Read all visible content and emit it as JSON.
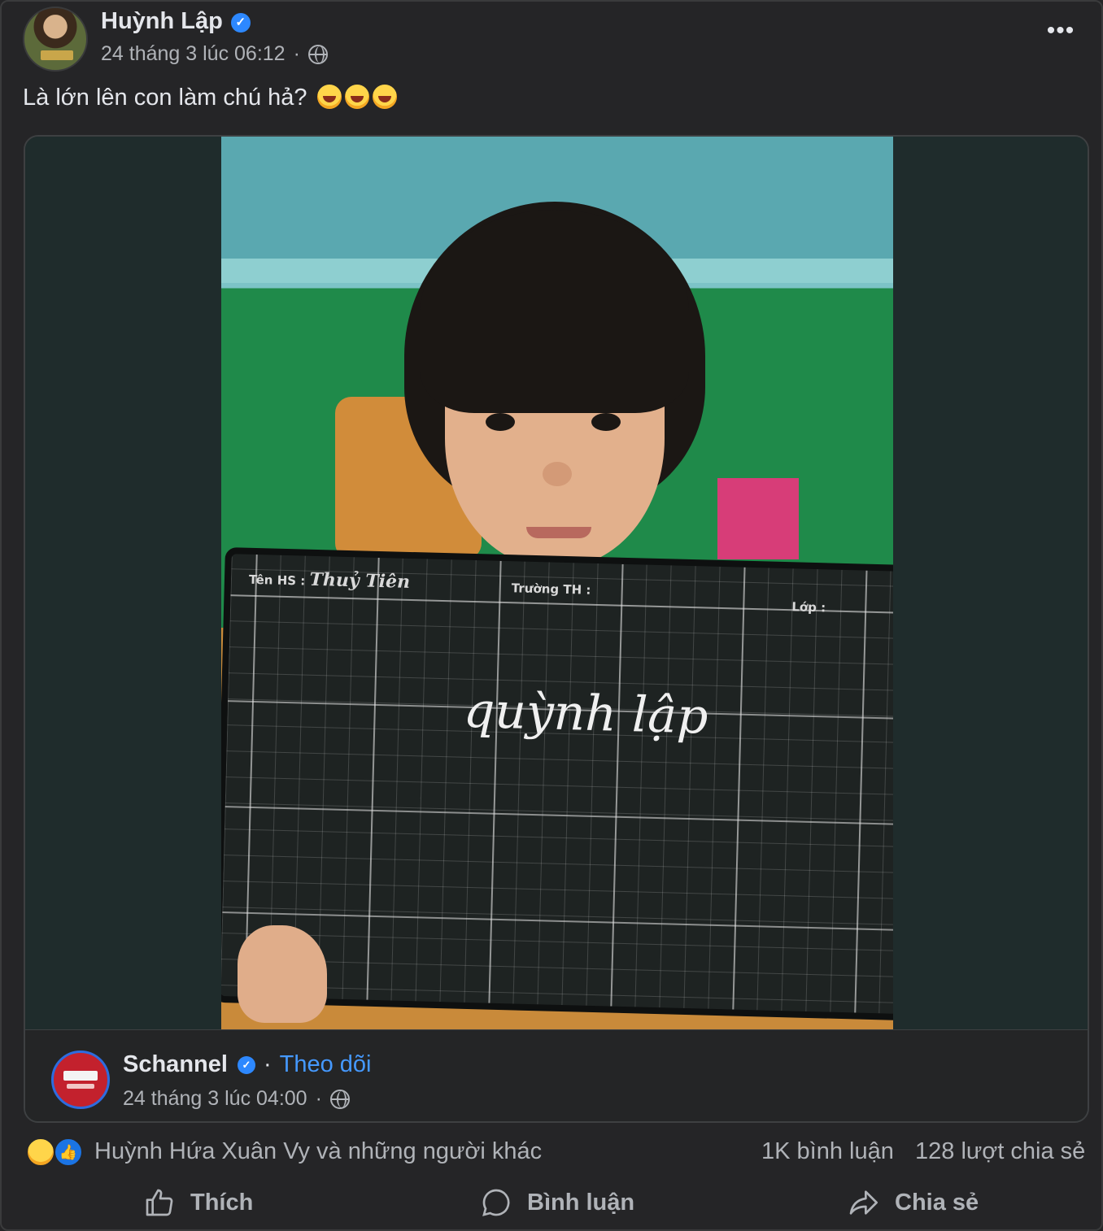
{
  "post": {
    "author": "Huỳnh Lập",
    "timestamp": "24 tháng 3 lúc 06:12",
    "privacy_icon": "globe-icon",
    "caption": "Là lớn lên con làm chú hả?",
    "caption_emojis": [
      "rolling-on-floor-laughing",
      "rolling-on-floor-laughing",
      "rolling-on-floor-laughing"
    ],
    "more_label": "•••"
  },
  "shared": {
    "slate": {
      "name_label": "Tên HS :",
      "name_value": "Thuỷ Tiên",
      "school_label": "Trường TH :",
      "class_label": "Lớp :",
      "handwriting": "quỳnh lập"
    },
    "page_name": "Schannel",
    "separator": "·",
    "follow_label": "Theo dõi",
    "page_timestamp": "24 tháng 3 lúc 04:00"
  },
  "stats": {
    "reactions": [
      "haha",
      "like"
    ],
    "reactors": "Huỳnh Hứa Xuân Vy và những người khác",
    "comments": "1K bình luận",
    "shares": "128 lượt chia sẻ"
  },
  "actions": {
    "like": "Thích",
    "comment": "Bình luận",
    "share": "Chia sẻ"
  },
  "colors": {
    "background": "#252527",
    "accent_blue": "#4599ff",
    "verified_blue": "#2d88ff",
    "text_primary": "#e4e6eb",
    "text_secondary": "#b0b3b8"
  }
}
